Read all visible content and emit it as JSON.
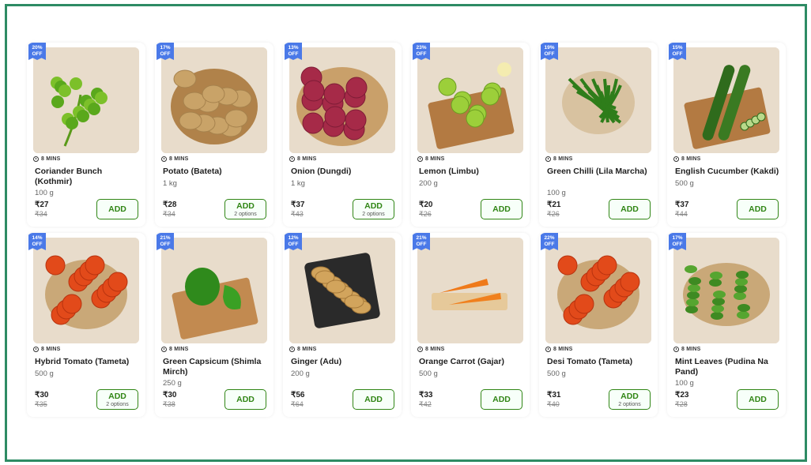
{
  "products": [
    {
      "discount": "20%",
      "off": "OFF",
      "eta": "8 MINS",
      "name": "Coriander Bunch (Kothmir)",
      "weight": "100 g",
      "price": "₹27",
      "mrp": "₹34",
      "add": "ADD",
      "options": "",
      "icon": "coriander"
    },
    {
      "discount": "17%",
      "off": "OFF",
      "eta": "8 MINS",
      "name": "Potato (Bateta)",
      "weight": "1 kg",
      "price": "₹28",
      "mrp": "₹34",
      "add": "ADD",
      "options": "2 options",
      "icon": "potato"
    },
    {
      "discount": "13%",
      "off": "OFF",
      "eta": "8 MINS",
      "name": "Onion (Dungdi)",
      "weight": "1 kg",
      "price": "₹37",
      "mrp": "₹43",
      "add": "ADD",
      "options": "2 options",
      "icon": "onion"
    },
    {
      "discount": "23%",
      "off": "OFF",
      "eta": "8 MINS",
      "name": "Lemon (Limbu)",
      "weight": "200 g",
      "price": "₹20",
      "mrp": "₹26",
      "add": "ADD",
      "options": "",
      "icon": "lemon"
    },
    {
      "discount": "19%",
      "off": "OFF",
      "eta": "8 MINS",
      "name": "Green Chilli (Lila Marcha)",
      "weight": "100 g",
      "price": "₹21",
      "mrp": "₹26",
      "add": "ADD",
      "options": "",
      "icon": "chilli"
    },
    {
      "discount": "15%",
      "off": "OFF",
      "eta": "8 MINS",
      "name": "English Cucumber (Kakdi)",
      "weight": "500 g",
      "price": "₹37",
      "mrp": "₹44",
      "add": "ADD",
      "options": "",
      "icon": "cucumber"
    },
    {
      "discount": "14%",
      "off": "OFF",
      "eta": "8 MINS",
      "name": "Hybrid Tomato (Tameta)",
      "weight": "500 g",
      "price": "₹30",
      "mrp": "₹35",
      "add": "ADD",
      "options": "2 options",
      "icon": "tomato"
    },
    {
      "discount": "21%",
      "off": "OFF",
      "eta": "8 MINS",
      "name": "Green Capsicum (Shimla Mirch)",
      "weight": "250 g",
      "price": "₹30",
      "mrp": "₹38",
      "add": "ADD",
      "options": "",
      "icon": "capsicum"
    },
    {
      "discount": "12%",
      "off": "OFF",
      "eta": "8 MINS",
      "name": "Ginger (Adu)",
      "weight": "200 g",
      "price": "₹56",
      "mrp": "₹64",
      "add": "ADD",
      "options": "",
      "icon": "ginger"
    },
    {
      "discount": "21%",
      "off": "OFF",
      "eta": "8 MINS",
      "name": "Orange Carrot (Gajar)",
      "weight": "500 g",
      "price": "₹33",
      "mrp": "₹42",
      "add": "ADD",
      "options": "",
      "icon": "carrot"
    },
    {
      "discount": "22%",
      "off": "OFF",
      "eta": "8 MINS",
      "name": "Desi Tomato (Tameta)",
      "weight": "500 g",
      "price": "₹31",
      "mrp": "₹40",
      "add": "ADD",
      "options": "2 options",
      "icon": "tomato"
    },
    {
      "discount": "17%",
      "off": "OFF",
      "eta": "8 MINS",
      "name": "Mint Leaves (Pudina Na Pand)",
      "weight": "100 g",
      "price": "₹23",
      "mrp": "₹28",
      "add": "ADD",
      "options": "",
      "icon": "mint"
    }
  ],
  "colors": {
    "accent": "#318616",
    "badge": "#4a79e8",
    "frame": "#2e8b64"
  }
}
